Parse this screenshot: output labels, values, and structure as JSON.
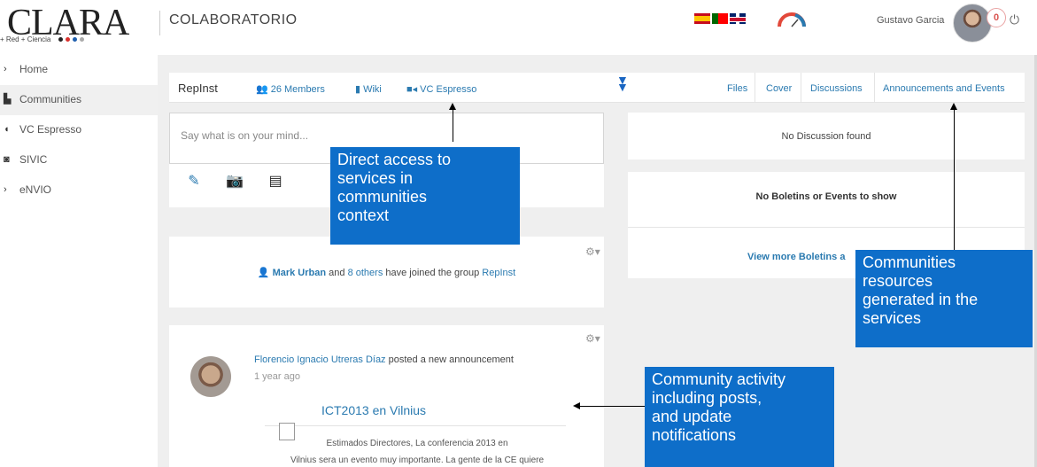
{
  "header": {
    "logo_text": "CLARA",
    "logo_tagline": "+ Red  + Ciencia",
    "app_title": "COLABORATORIO",
    "user_name": "Gustavo Garcia",
    "notification_count": "0",
    "power_icon": "power-icon",
    "flags": [
      "spain-flag-icon",
      "portugal-flag-icon",
      "uk-flag-icon"
    ]
  },
  "sidebar": {
    "items": [
      {
        "label": "Home",
        "icon": "home-icon"
      },
      {
        "label": "Communities",
        "icon": "communities-icon"
      },
      {
        "label": "VC Espresso",
        "icon": "vc-icon"
      },
      {
        "label": "SIVIC",
        "icon": "sivic-icon"
      },
      {
        "label": "eNVIO",
        "icon": "envio-icon"
      }
    ]
  },
  "group_bar": {
    "group_name": "RepInst",
    "members": "26 Members",
    "wiki": "Wiki",
    "vc": "VC Espresso",
    "tabs": [
      "Files",
      "Cover",
      "Discussions",
      "Announcements and Events"
    ]
  },
  "post_box": {
    "placeholder": "Say what is on your mind..."
  },
  "joined_card": {
    "person": "Mark Urban",
    "and": "and",
    "others": "8 others",
    "text": "have joined the group",
    "group": "RepInst"
  },
  "announcement": {
    "author": "Florencio Ignacio Utreras Díaz",
    "action": "posted a new announcement",
    "time": "1 year ago",
    "title": "ICT2013 en Vilnius",
    "body_line1": "Estimados Directores, La conferencia 2013 en",
    "body_line2": "Vilnius sera un evento muy importante. La gente de la CE quiere"
  },
  "right_cards": {
    "no_discussion": "No Discussion found",
    "no_boletins": "No Boletins or Events to show",
    "view_more": "View more Boletins a"
  },
  "callouts": {
    "services": [
      "Direct access to",
      "services in",
      "communities",
      "context"
    ],
    "resources": [
      "Communities",
      "resources",
      "generated in the",
      "services"
    ],
    "activity": [
      "Community activity",
      "including posts,",
      "and update",
      "notifications"
    ]
  },
  "colors": {
    "accent_link": "#2a7ab0",
    "callout_blue": "#0e6ec9",
    "background_gray": "#efefef"
  }
}
